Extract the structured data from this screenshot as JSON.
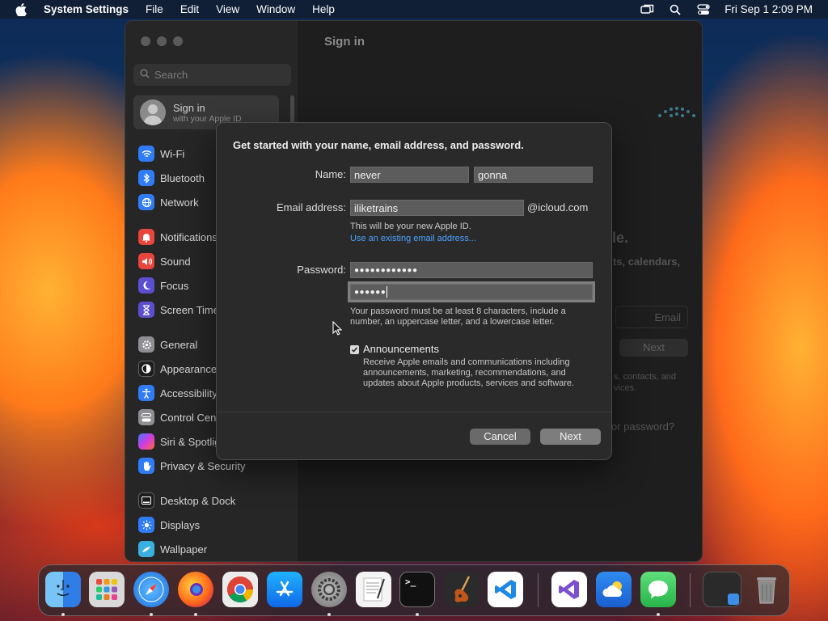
{
  "menubar": {
    "app_name": "System Settings",
    "menus": [
      "File",
      "Edit",
      "View",
      "Window",
      "Help"
    ],
    "clock": "Fri Sep 1  2:09 PM"
  },
  "window": {
    "title": "Sign in",
    "search_placeholder": "Search",
    "account": {
      "title": "Sign in",
      "subtitle": "with your Apple ID"
    },
    "sidebar": {
      "items": [
        {
          "label": "Wi-Fi",
          "icon": "wifi-icon",
          "color": "#2f7cf6"
        },
        {
          "label": "Bluetooth",
          "icon": "bluetooth-icon",
          "color": "#2f7cf6"
        },
        {
          "label": "Network",
          "icon": "globe-icon",
          "color": "#2f7cf6"
        },
        {
          "label": "Notifications",
          "icon": "bell-icon",
          "color": "#e8453c"
        },
        {
          "label": "Sound",
          "icon": "speaker-icon",
          "color": "#e8453c"
        },
        {
          "label": "Focus",
          "icon": "moon-icon",
          "color": "#5b4fd0"
        },
        {
          "label": "Screen Time",
          "icon": "hourglass-icon",
          "color": "#5b4fd0"
        },
        {
          "label": "General",
          "icon": "gear-icon",
          "color": "#8e8e93"
        },
        {
          "label": "Appearance",
          "icon": "appearance-icon",
          "color": "#1c1c1e"
        },
        {
          "label": "Accessibility",
          "icon": "accessibility-icon",
          "color": "#2f7cf6"
        },
        {
          "label": "Control Centre",
          "icon": "control-centre-icon",
          "color": "#8e8e93"
        },
        {
          "label": "Siri & Spotlight",
          "icon": "siri-icon",
          "color": "#b04ad8"
        },
        {
          "label": "Privacy & Security",
          "icon": "hand-icon",
          "color": "#2f7cf6"
        },
        {
          "label": "Desktop & Dock",
          "icon": "dock-icon",
          "color": "#1c1c1e"
        },
        {
          "label": "Displays",
          "icon": "sun-icon",
          "color": "#2f7cf6"
        },
        {
          "label": "Wallpaper",
          "icon": "wallpaper-icon",
          "color": "#3ab0e0"
        }
      ]
    },
    "background_text": {
      "fragment_1": "le.",
      "fragment_2": "ts, calendars,",
      "email_field": "Email",
      "next_button": "Next",
      "fragment_3": "s, contacts, and",
      "fragment_4": "vices.",
      "fragment_5": "or password?"
    }
  },
  "sheet": {
    "heading": "Get started with your name, email address, and password.",
    "name_label": "Name:",
    "first_name": "never",
    "last_name": "gonna",
    "email_label": "Email address:",
    "email_value": "iliketrains",
    "email_domain": "@icloud.com",
    "email_note": "This will be your new Apple ID.",
    "existing_email_link": "Use an existing email address...",
    "password_label": "Password:",
    "password_value": "●●●●●●●●●●●●",
    "verify_value": "●●●●●●",
    "password_note_1": "Your password must be at least 8 characters, include a",
    "password_note_2": "number, an uppercase letter, and a lowercase letter.",
    "announcements_checked": true,
    "announcements_title": "Announcements",
    "announcements_note_1": "Receive Apple emails and communications including",
    "announcements_note_2": "announcements, marketing, recommendations, and",
    "announcements_note_3": "updates about Apple products, services and software.",
    "cancel_label": "Cancel",
    "next_label": "Next"
  },
  "dock": {
    "apps": [
      {
        "name": "finder-icon",
        "color": "#3d8ee8",
        "running": true
      },
      {
        "name": "launchpad-icon",
        "color": "#d0d0d0",
        "running": false
      },
      {
        "name": "safari-icon",
        "color": "#1d8df0",
        "running": true
      },
      {
        "name": "firefox-icon",
        "color": "#ff6a1a",
        "running": true
      },
      {
        "name": "chrome-icon",
        "color": "#f2f2f2",
        "running": false
      },
      {
        "name": "app-store-icon",
        "color": "#1a8cf6",
        "running": false
      },
      {
        "name": "system-settings-icon",
        "color": "#8a8a8a",
        "running": true
      },
      {
        "name": "textedit-icon",
        "color": "#f1f1f1",
        "running": false
      },
      {
        "name": "terminal-icon",
        "color": "#1a1a1a",
        "running": true
      },
      {
        "name": "garageband-icon",
        "color": "#2b2b2b",
        "running": false
      },
      {
        "name": "vscode-icon",
        "color": "#ffffff",
        "running": false
      },
      {
        "name": "visual-studio-icon",
        "color": "#ffffff",
        "running": false
      },
      {
        "name": "icloud-weather-icon",
        "color": "#2a7be6",
        "running": false
      },
      {
        "name": "messages-icon",
        "color": "#34c759",
        "running": true
      },
      {
        "name": "minimized-window-icon",
        "color": "#333333",
        "running": false
      },
      {
        "name": "trash-icon",
        "color": "#777777",
        "running": false
      }
    ]
  }
}
